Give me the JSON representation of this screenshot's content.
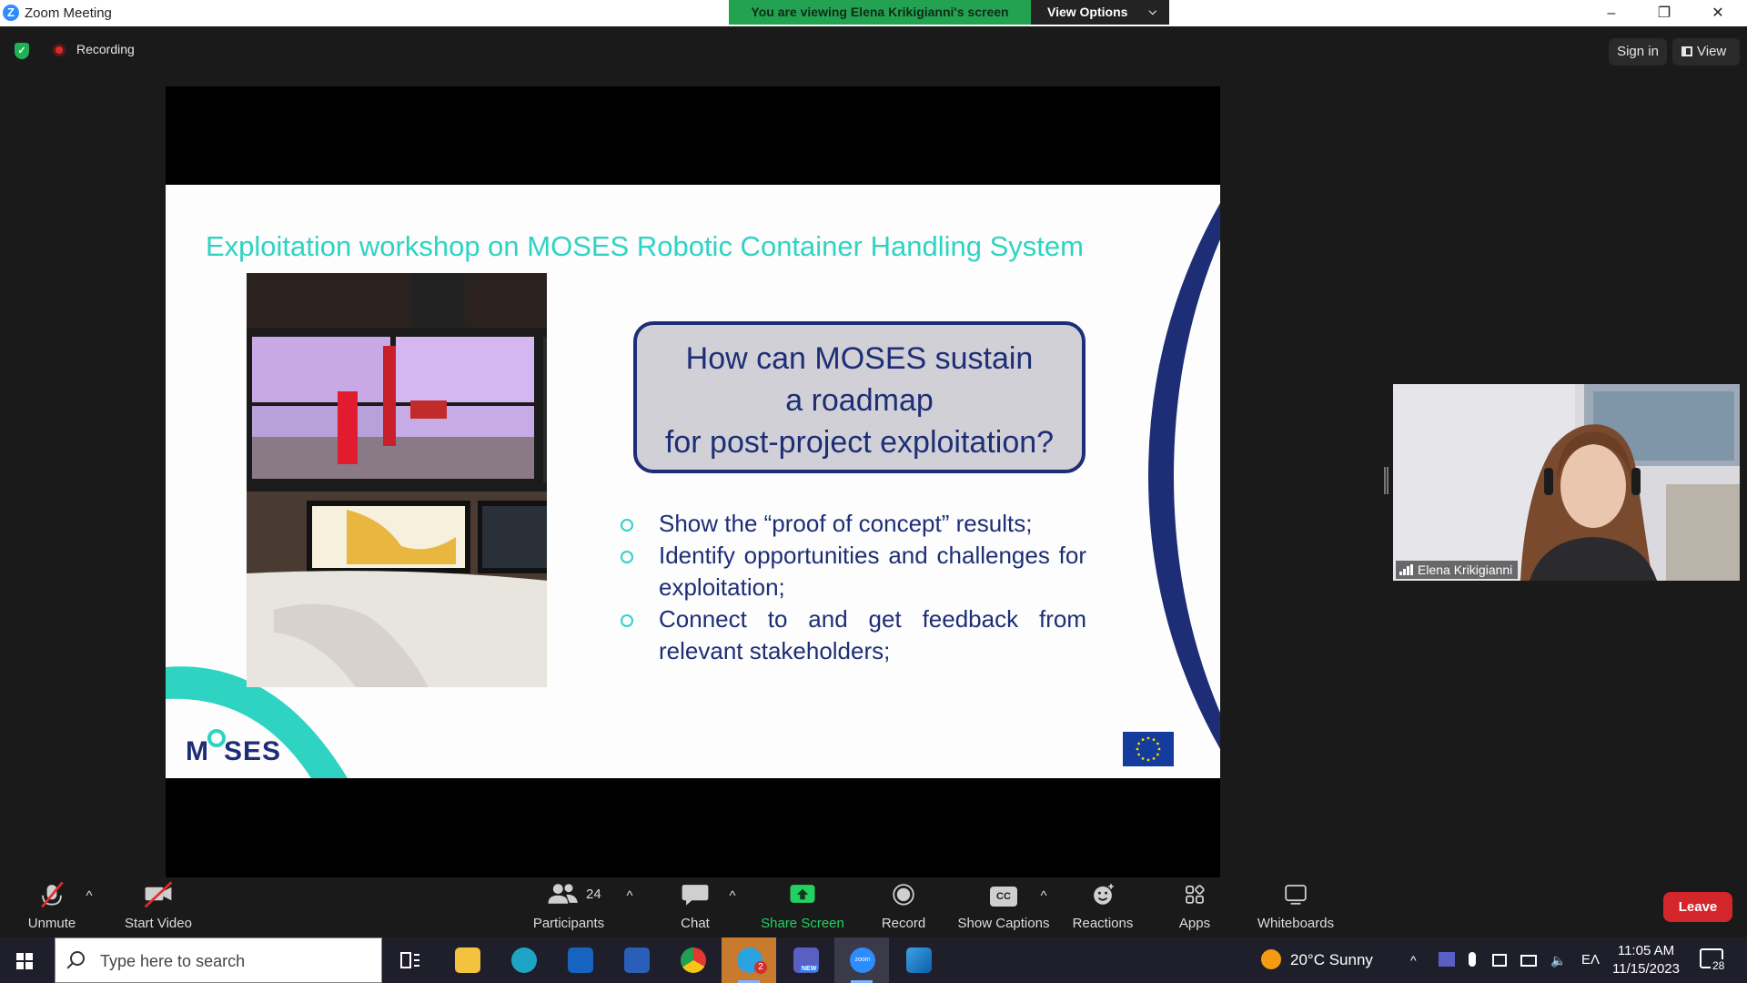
{
  "window": {
    "title": "Zoom Meeting",
    "banner": "You are viewing Elena Krikigianni's screen",
    "view_options": "View Options",
    "controls": [
      "–",
      "❐",
      "✕"
    ]
  },
  "topbar": {
    "recording_label": "Recording",
    "sign_in": "Sign in",
    "view": "View"
  },
  "slide": {
    "title": "Exploitation workshop on MOSES Robotic Container Handling System",
    "question_lines": [
      "How can MOSES sustain",
      "a roadmap",
      "for post-project exploitation?"
    ],
    "bullets": [
      "Show the “proof of concept” results;",
      "Identify opportunities and challenges for exploitation;",
      "Connect to and get feedback from relevant stakeholders;"
    ],
    "logo_left": "M",
    "logo_right": "SES",
    "accent_color": "#2fd3c2",
    "navy_color": "#1d2e76"
  },
  "participant": {
    "name": "Elena Krikigianni"
  },
  "toolbar": {
    "unmute": "Unmute",
    "start_video": "Start Video",
    "participants": "Participants",
    "participant_count": "24",
    "chat": "Chat",
    "share_screen": "Share Screen",
    "record": "Record",
    "show_captions": "Show Captions",
    "cc_badge": "CC",
    "reactions": "Reactions",
    "apps": "Apps",
    "whiteboards": "Whiteboards",
    "leave": "Leave",
    "leave_color": "#d3262b",
    "share_color": "#23d160"
  },
  "taskbar": {
    "search_placeholder": "Type here to search",
    "weather": "20°C  Sunny",
    "language": "ΕΛ",
    "time": "11:05 AM",
    "date": "11/15/2023",
    "notifications": "28",
    "skype_badge": "2",
    "teams_badge": "NEW",
    "zoom_label": "zoom"
  }
}
